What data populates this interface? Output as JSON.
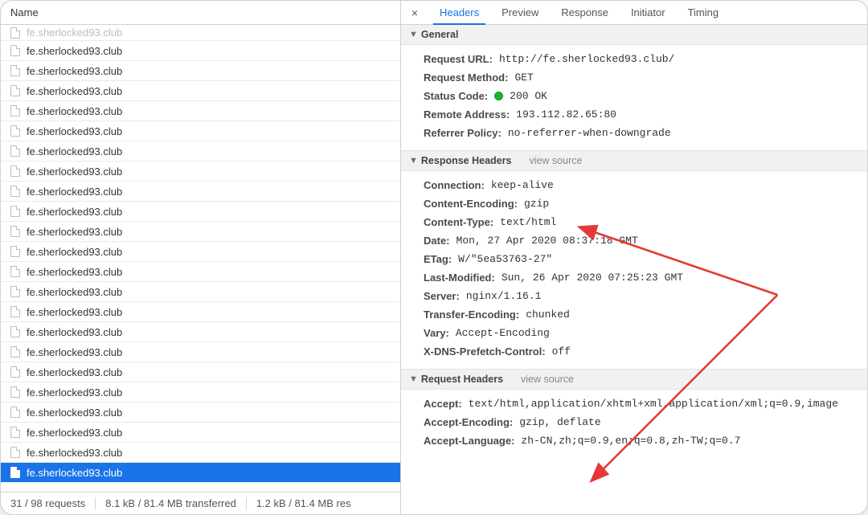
{
  "left": {
    "header": "Name",
    "partial_top": "fe.sherlocked93.club",
    "rows": [
      "fe.sherlocked93.club",
      "fe.sherlocked93.club",
      "fe.sherlocked93.club",
      "fe.sherlocked93.club",
      "fe.sherlocked93.club",
      "fe.sherlocked93.club",
      "fe.sherlocked93.club",
      "fe.sherlocked93.club",
      "fe.sherlocked93.club",
      "fe.sherlocked93.club",
      "fe.sherlocked93.club",
      "fe.sherlocked93.club",
      "fe.sherlocked93.club",
      "fe.sherlocked93.club",
      "fe.sherlocked93.club",
      "fe.sherlocked93.club",
      "fe.sherlocked93.club",
      "fe.sherlocked93.club",
      "fe.sherlocked93.club",
      "fe.sherlocked93.club",
      "fe.sherlocked93.club",
      "fe.sherlocked93.club"
    ],
    "selected_index": 21,
    "statusbar": {
      "requests": "31 / 98 requests",
      "transferred": "8.1 kB / 81.4 MB transferred",
      "resources": "1.2 kB / 81.4 MB res"
    }
  },
  "tabs": {
    "close_glyph": "×",
    "items": [
      "Headers",
      "Preview",
      "Response",
      "Initiator",
      "Timing"
    ],
    "active_index": 0
  },
  "sections": {
    "general": {
      "title": "General",
      "rows": [
        {
          "k": "Request URL:",
          "v": "http://fe.sherlocked93.club/"
        },
        {
          "k": "Request Method:",
          "v": "GET"
        },
        {
          "k": "Status Code:",
          "v": "200 OK",
          "status": true
        },
        {
          "k": "Remote Address:",
          "v": "193.112.82.65:80"
        },
        {
          "k": "Referrer Policy:",
          "v": "no-referrer-when-downgrade"
        }
      ]
    },
    "response": {
      "title": "Response Headers",
      "view_source": "view source",
      "rows": [
        {
          "k": "Connection:",
          "v": "keep-alive"
        },
        {
          "k": "Content-Encoding:",
          "v": "gzip"
        },
        {
          "k": "Content-Type:",
          "v": "text/html"
        },
        {
          "k": "Date:",
          "v": "Mon, 27 Apr 2020 08:37:18 GMT"
        },
        {
          "k": "ETag:",
          "v": "W/\"5ea53763-27\""
        },
        {
          "k": "Last-Modified:",
          "v": "Sun, 26 Apr 2020 07:25:23 GMT"
        },
        {
          "k": "Server:",
          "v": "nginx/1.16.1"
        },
        {
          "k": "Transfer-Encoding:",
          "v": "chunked"
        },
        {
          "k": "Vary:",
          "v": "Accept-Encoding"
        },
        {
          "k": "X-DNS-Prefetch-Control:",
          "v": "off"
        }
      ]
    },
    "request": {
      "title": "Request Headers",
      "view_source": "view source",
      "rows": [
        {
          "k": "Accept:",
          "v": "text/html,application/xhtml+xml,application/xml;q=0.9,image"
        },
        {
          "k": "Accept-Encoding:",
          "v": "gzip, deflate"
        },
        {
          "k": "Accept-Language:",
          "v": "zh-CN,zh;q=0.9,en;q=0.8,zh-TW;q=0.7"
        }
      ]
    }
  }
}
